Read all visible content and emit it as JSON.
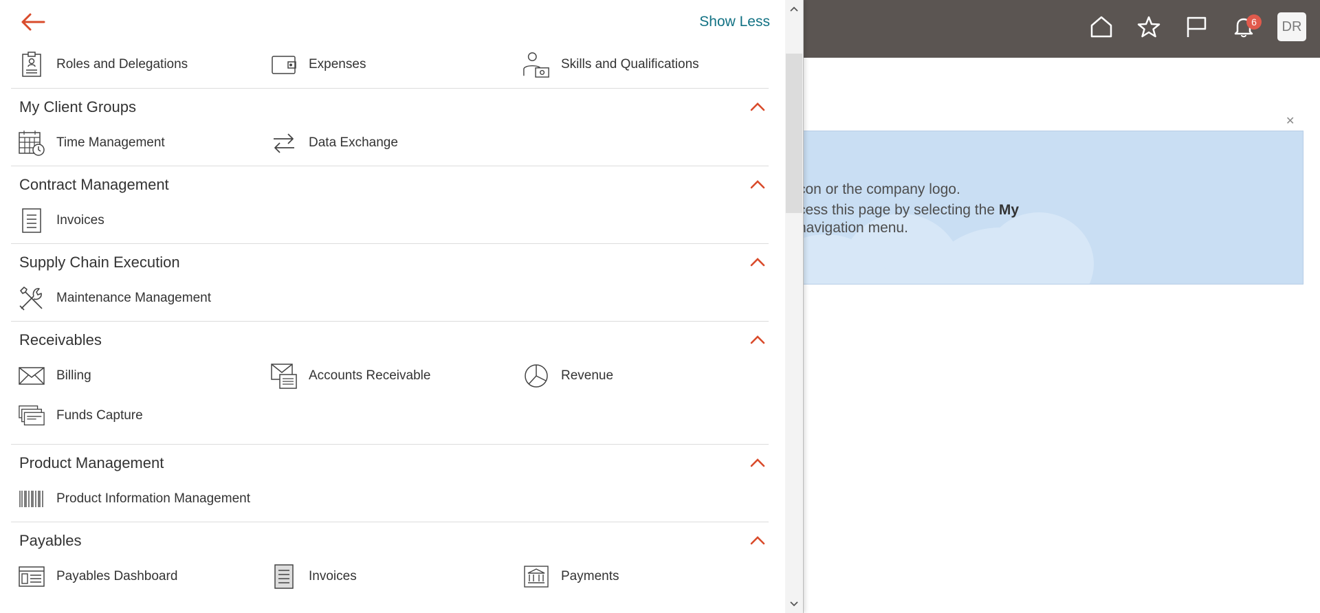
{
  "header": {
    "notification_count": "6",
    "avatar_initials": "DR"
  },
  "banner": {
    "line1": "con or the company logo.",
    "line2": "cess this page by selecting the ",
    "line2_bold": "My",
    "line3": " navigation menu."
  },
  "drawer": {
    "show_less": "Show Less",
    "top_items": [
      {
        "label": "Roles and Delegations",
        "icon": "badge-icon"
      },
      {
        "label": "Expenses",
        "icon": "wallet-icon"
      },
      {
        "label": "Skills and Qualifications",
        "icon": "person-certificate-icon"
      }
    ],
    "sections": [
      {
        "title": "My Client Groups",
        "items": [
          {
            "label": "Time Management",
            "icon": "calendar-clock-icon"
          },
          {
            "label": "Data Exchange",
            "icon": "exchange-arrows-icon"
          }
        ]
      },
      {
        "title": "Contract Management",
        "items": [
          {
            "label": "Invoices",
            "icon": "document-icon"
          }
        ]
      },
      {
        "title": "Supply Chain Execution",
        "items": [
          {
            "label": "Maintenance Management",
            "icon": "tools-icon"
          }
        ]
      },
      {
        "title": "Receivables",
        "items": [
          {
            "label": "Billing",
            "icon": "envelope-icon"
          },
          {
            "label": "Accounts Receivable",
            "icon": "envelope-document-icon"
          },
          {
            "label": "Revenue",
            "icon": "pie-chart-icon"
          },
          {
            "label": "Funds Capture",
            "icon": "stacked-cards-icon"
          }
        ]
      },
      {
        "title": "Product Management",
        "items": [
          {
            "label": "Product Information Management",
            "icon": "barcode-icon"
          }
        ]
      },
      {
        "title": "Payables",
        "items": [
          {
            "label": "Payables Dashboard",
            "icon": "dashboard-icon"
          },
          {
            "label": "Invoices",
            "icon": "invoice-list-icon"
          },
          {
            "label": "Payments",
            "icon": "bank-icon"
          }
        ]
      }
    ]
  },
  "colors": {
    "accent": "#d94b2b",
    "link": "#117183",
    "topbar": "#5b5552"
  }
}
